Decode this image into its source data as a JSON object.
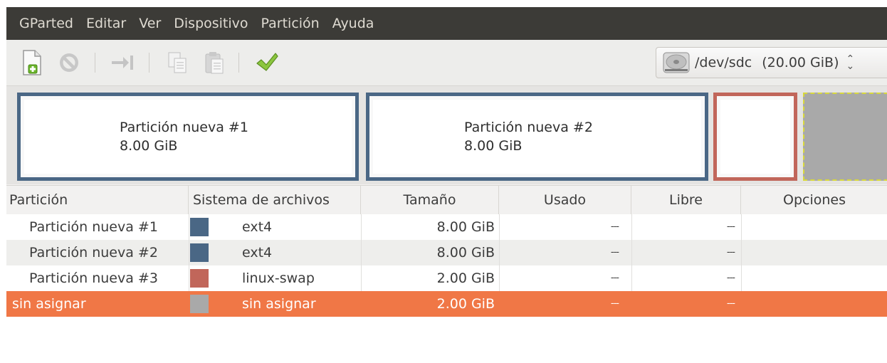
{
  "menubar": {
    "items": [
      "GParted",
      "Editar",
      "Ver",
      "Dispositivo",
      "Partición",
      "Ayuda"
    ]
  },
  "toolbar": {
    "buttons": [
      "new-partition",
      "delete",
      "resize-move",
      "copy",
      "paste",
      "apply"
    ],
    "device": {
      "path": "/dev/sdc",
      "size": "(20.00 GiB)"
    }
  },
  "visual": {
    "p1": {
      "name": "Partición nueva #1",
      "size": "8.00 GiB"
    },
    "p2": {
      "name": "Partición nueva #2",
      "size": "8.00 GiB"
    }
  },
  "columns": [
    "Partición",
    "Sistema de archivos",
    "Tamaño",
    "Usado",
    "Libre",
    "Opciones"
  ],
  "rows": [
    {
      "partition": "Partición nueva #1",
      "fs": "ext4",
      "size": "8.00 GiB",
      "used": "---",
      "free": "---",
      "color": "#4a6785"
    },
    {
      "partition": "Partición nueva #2",
      "fs": "ext4",
      "size": "8.00 GiB",
      "used": "---",
      "free": "---",
      "color": "#4a6785"
    },
    {
      "partition": "Partición nueva #3",
      "fs": "linux-swap",
      "size": "2.00 GiB",
      "used": "---",
      "free": "---",
      "color": "#c1665a"
    },
    {
      "partition": "sin asignar",
      "fs": "sin asignar",
      "size": "2.00 GiB",
      "used": "---",
      "free": "---",
      "color": "#a9a9a9"
    }
  ],
  "colors": {
    "ext4": "#4a6785",
    "swap": "#c1665a",
    "unallocated": "#a9a9a9",
    "selection": "#f07746",
    "menubar": "#3c3b37"
  }
}
